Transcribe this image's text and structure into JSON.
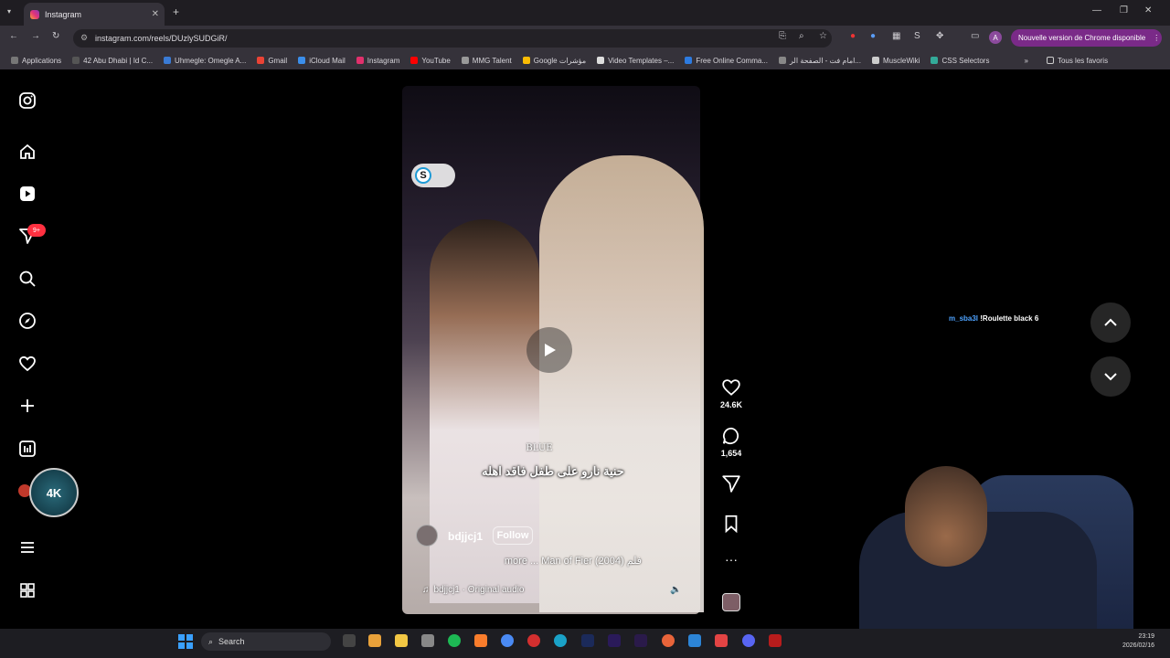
{
  "browser": {
    "tab_title": "Instagram",
    "url": "instagram.com/reels/DUzlySUDGiR/",
    "update_label": "Nouvelle version de Chrome disponible",
    "bookmarks": [
      "Applications",
      "42 Abu Dhabi | Id C...",
      "Uhmegle: Omegle A...",
      "Gmail",
      "iCloud Mail",
      "Instagram",
      "YouTube",
      "MMG Talent",
      "Google مؤشرات",
      "Video Templates –...",
      "Free Online Comma...",
      "امام فت - الصفحة الر...",
      "MuscleWiki",
      "CSS Selectors"
    ],
    "all_bookmarks": "Tous les favoris"
  },
  "sidebar": {
    "notifications_badge": "9+",
    "avatar_text": "4K"
  },
  "reel": {
    "author": "bdjjcj1",
    "follow_label": "Follow",
    "description": "more ... Man of Fier (2004) فلم",
    "audio": "bdjjcj1 · Original audio",
    "caption": "حنية نارو على طفل فاقد اهله",
    "overlay_word": "BLUE",
    "likes": "24.6K",
    "comments": "1,654"
  },
  "overlay": {
    "username": "m_sba3l",
    "message": "!Roulette black 6"
  },
  "taskbar": {
    "search_label": "Search",
    "time": "23:19",
    "date": "2026/02/16"
  },
  "colors": {
    "accent": "#ff3040",
    "update_pill": "#7a2a88",
    "link_blue": "#4ea3ff"
  }
}
